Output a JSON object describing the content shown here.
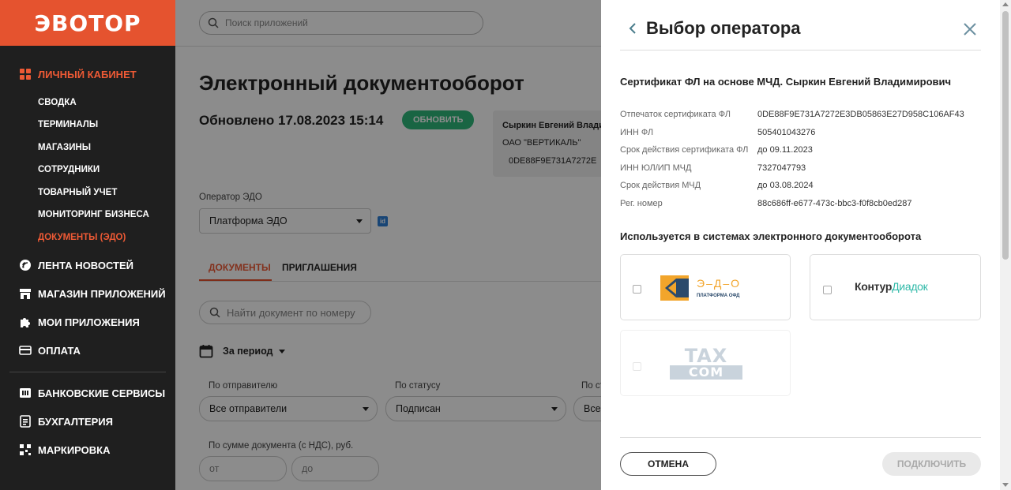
{
  "brand": {
    "logo_text": "ЭВОТОР",
    "accent": "#e5532f",
    "success": "#2eb87b"
  },
  "sidebar": {
    "section_cabinet": "Личный кабинет",
    "sub_items": [
      {
        "label": "Сводка"
      },
      {
        "label": "Терминалы"
      },
      {
        "label": "Магазины"
      },
      {
        "label": "Сотрудники"
      },
      {
        "label": "Товарный учет"
      },
      {
        "label": "Мониторинг бизнеса"
      },
      {
        "label": "Документы (ЭДО)"
      }
    ],
    "sections": [
      {
        "label": "Лента новостей",
        "icon": "news-icon"
      },
      {
        "label": "Магазин приложений",
        "icon": "store-icon"
      },
      {
        "label": "Мои приложения",
        "icon": "puzzle-icon"
      },
      {
        "label": "Оплата",
        "icon": "card-icon"
      },
      {
        "label": "Банковские сервисы",
        "icon": "bank-icon"
      },
      {
        "label": "Бухгалтерия",
        "icon": "accounting-icon"
      },
      {
        "label": "Маркировка",
        "icon": "marking-icon"
      }
    ]
  },
  "main": {
    "search_placeholder": "Поиск приложений",
    "title": "Электронный документооборот",
    "updated": "Обновлено 17.08.2023 15:14",
    "refresh_label": "Обновить",
    "cert_card": {
      "name": "Сыркин Евгений Влади",
      "org": "ОАО \"ВЕРТИКАЛЬ\"",
      "fingerprint": "0DE88F9E731A7272E"
    },
    "operator_label": "Оператор ЭДО",
    "operator_value": "Платформа ЭДО",
    "id_badge": "id",
    "tabs": [
      {
        "label": "Документы"
      },
      {
        "label": "Приглашения"
      }
    ],
    "doc_search_placeholder": "Найти документ по номеру",
    "period_label": "За период",
    "filters": {
      "sender_label": "По отправителю",
      "sender_value": "Все отправители",
      "status_label": "По статусу",
      "status_value": "Подписан",
      "third_label": "По ст",
      "third_value": "Все",
      "sum_label": "По сумме документа (с НДС), руб.",
      "sum_from": "от",
      "sum_to": "до"
    }
  },
  "panel": {
    "title": "Выбор оператора",
    "cert_title": "Сертификат ФЛ на основе МЧД. Сыркин Евгений Владимирович",
    "fields": [
      {
        "key": "Отпечаток сертификата ФЛ",
        "value": "0DE88F9E731A7272E3DB05863E27D958C106AF43"
      },
      {
        "key": "ИНН ФЛ",
        "value": "505401043276"
      },
      {
        "key": "Срок действия сертификата ФЛ",
        "value": "до 09.11.2023"
      },
      {
        "key": "ИНН ЮЛ/ИП МЧД",
        "value": "7327047793"
      },
      {
        "key": "Срок действия МЧД",
        "value": "до 03.08.2024"
      },
      {
        "key": "Рег. номер",
        "value": "88c686ff-e677-473c-bbc3-f0f8cb0ed287"
      }
    ],
    "used_title": "Используется в системах электронного документооборота",
    "operators": {
      "edo": {
        "name": "Э–Д–О",
        "sub": "ПЛАТФОРМА ОФД"
      },
      "kontur": {
        "name_a": "Контур",
        "name_b": "Диадок"
      },
      "taxcom": {
        "line1": "TAX",
        "line2": "COM"
      }
    },
    "cancel_label": "Отмена",
    "connect_label": "Подключить"
  }
}
